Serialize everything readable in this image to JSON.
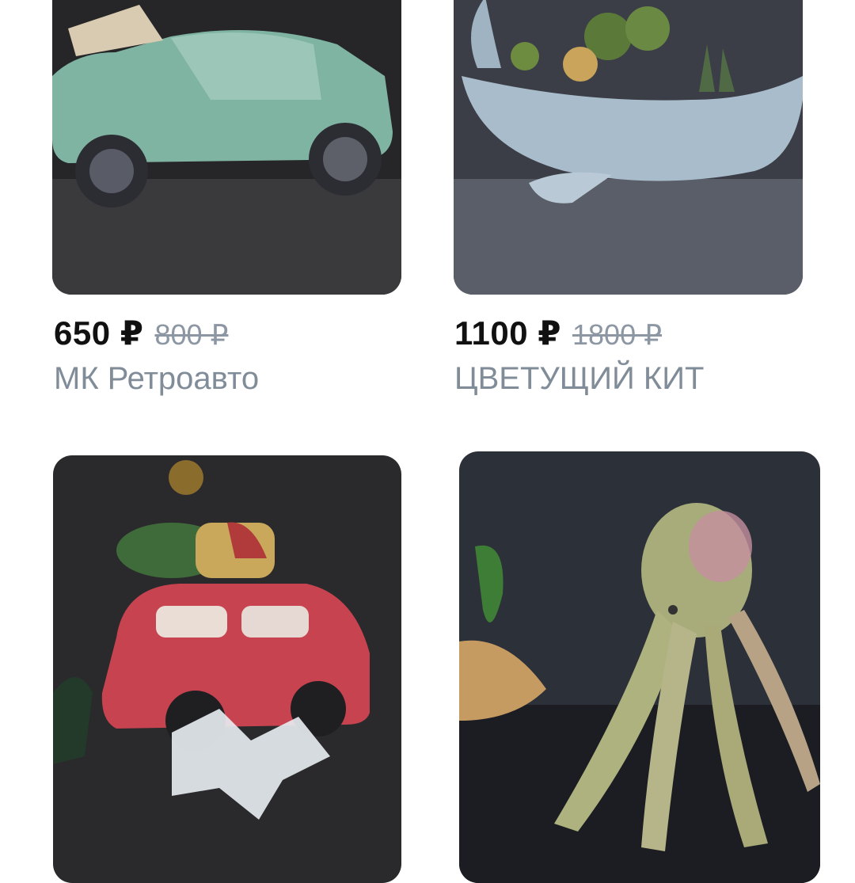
{
  "products": [
    {
      "price": "650 ₽",
      "old_price": "800 ₽",
      "title": "МК Ретроавто",
      "image_icon": "retro-car-photo"
    },
    {
      "price": "1100 ₽",
      "old_price": "1800 ₽",
      "title": "ЦВЕТУЩИЙ КИТ",
      "image_icon": "whale-planter-photo"
    },
    {
      "image_icon": "red-car-christmas-photo"
    },
    {
      "image_icon": "octopus-figure-photo"
    }
  ]
}
